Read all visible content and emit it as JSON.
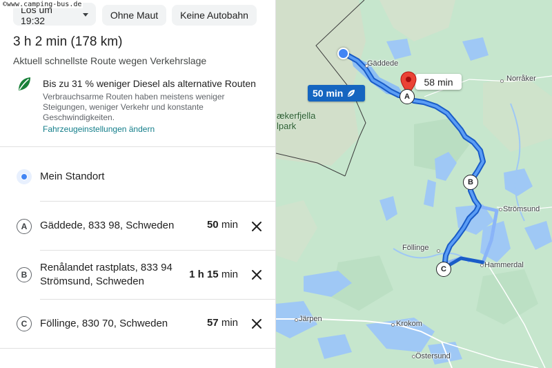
{
  "watermark": "©www.camping-bus.de",
  "options": {
    "depart_label": "Los um 19:32",
    "no_toll_label": "Ohne Maut",
    "no_highway_label": "Keine Autobahn"
  },
  "route": {
    "duration": "3 h 2 min (178 km)",
    "subtitle": "Aktuell schnellste Route wegen Verkehrslage"
  },
  "eco": {
    "title": "Bis zu 31 % weniger Diesel als alternative Routen",
    "description": "Verbrauchsarme Routen haben meistens weniger Steigungen, weniger Verkehr und konstante Geschwindigkeiten.",
    "link": "Fahrzeugeinstellungen ändern"
  },
  "stops": [
    {
      "marker": "",
      "label": "Mein Standort",
      "time_bold": "",
      "time_rest": ""
    },
    {
      "marker": "A",
      "label": "Gäddede, 833 98, Schweden",
      "time_bold": "50",
      "time_rest": " min"
    },
    {
      "marker": "B",
      "label": "Renålandet rastplats, 833 94 Strömsund, Schweden",
      "time_bold": "1 h 15",
      "time_rest": " min"
    },
    {
      "marker": "C",
      "label": "Föllinge, 830 70, Schweden",
      "time_bold": "57",
      "time_rest": " min"
    }
  ],
  "map": {
    "route_badge": "50 min",
    "alt_badge": "58 min",
    "places": {
      "gaddede": "Gäddede",
      "norraker": "Norråker",
      "stromsund": "Strömsund",
      "follinge": "Föllinge",
      "hammerdal": "Hammerdal",
      "jarpen": "Järpen",
      "krokom": "Krokom",
      "ostersund": "Östersund"
    },
    "park_line1": "ækerfjella",
    "park_line2": "lpark",
    "waypoints": [
      "A",
      "B",
      "C"
    ],
    "colors": {
      "route_main": "#1a73e8",
      "route_alt": "#8ab4f8",
      "land": "#c8e6cf",
      "water": "#9fc8f5",
      "mountain": "#d8dcc8"
    }
  }
}
